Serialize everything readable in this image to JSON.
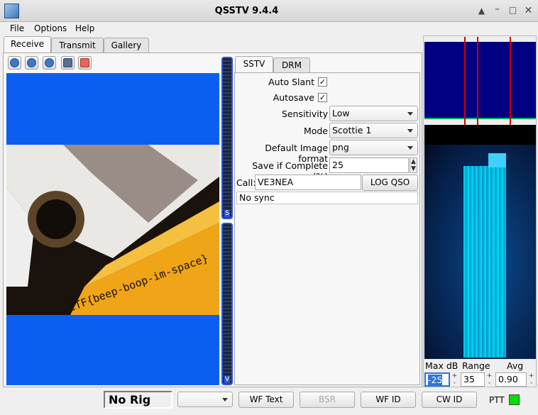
{
  "window": {
    "title": "QSSTV 9.4.4"
  },
  "menu": [
    "File",
    "Options",
    "Help"
  ],
  "main_tabs": [
    "Receive",
    "Transmit",
    "Gallery"
  ],
  "toolbar": {
    "icons": [
      "start-icon",
      "stop-icon",
      "replay-icon",
      "save-icon",
      "erase-icon"
    ]
  },
  "image": {
    "overlay_text": "CTF{beep-boop-im-space}"
  },
  "vu": {
    "top_label": "S",
    "bottom_label": "V"
  },
  "mode_tabs": [
    "SSTV",
    "DRM"
  ],
  "settings": {
    "auto_slant_label": "Auto Slant",
    "auto_slant_checked": "✓",
    "autosave_label": "Autosave",
    "autosave_checked": "✓",
    "sensitivity_label": "Sensitivity",
    "sensitivity_value": "Low",
    "mode_label": "Mode",
    "mode_value": "Scottie 1",
    "image_format_label": "Default Image format",
    "image_format_value": "png",
    "save_complete_label": "Save if Complete (%)",
    "save_complete_value": "25",
    "call_label": "Call:",
    "call_value": "VE3NEA",
    "log_qso_label": "LOG QSO",
    "status": "No sync"
  },
  "waterfall": {
    "max_db_label": "Max dB",
    "range_label": "Range",
    "avg_label": "Avg",
    "max_db_value": "-25",
    "range_value": "35",
    "avg_value": "0.90",
    "colors": {
      "background": "#000080",
      "signal": "#00e5ff"
    }
  },
  "statusbar": {
    "rig": "No Rig",
    "wf_text": "WF Text",
    "bsr": "BSR",
    "wf_id": "WF ID",
    "cw_id": "CW ID",
    "ptt": "PTT",
    "ptt_color": "#00e000"
  }
}
